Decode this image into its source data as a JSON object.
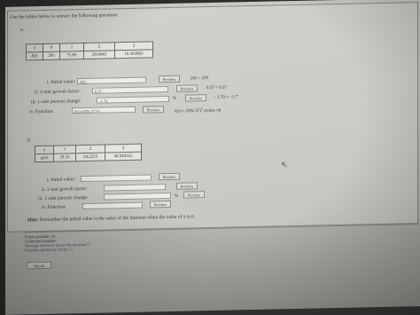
{
  "instructions": "Use the tables below to answer the following questions.",
  "part_a": {
    "label": "a.",
    "table": {
      "headers": [
        "x",
        "0",
        "1",
        "2",
        "3"
      ],
      "row_label": "f(x)",
      "values": [
        "205",
        "75.85",
        "28.0645",
        "10.383865"
      ]
    },
    "rows": [
      {
        "label": "i. Initial value:",
        "value": "205",
        "button": "Preview",
        "result": "205 = 205"
      },
      {
        "label": "ii. 1-unit growth factor:",
        "value": "0.37",
        "button": "Preview",
        "result": "0.37 = 0.37"
      },
      {
        "label": "iii. 1-unit percent change:",
        "value": "-1.70",
        "unit": "%",
        "button": "Preview",
        "result": "− 1.70 = −1.7"
      },
      {
        "label": "iv. Function:",
        "value": "f(x)=205(.37)^x",
        "button": "Preview",
        "result": "f(x) = 205(.37)",
        "result_sup": "x",
        "result_tail": "syntax ok"
      }
    ]
  },
  "part_b": {
    "label": "b.",
    "table": {
      "headers": [
        "x",
        "1",
        "2",
        "3"
      ],
      "row_label": "g(x)",
      "values": [
        "29.35",
        "34.2225",
        "40.049325"
      ]
    },
    "rows": [
      {
        "label": "i. Initial value:",
        "value": "",
        "button": "Preview"
      },
      {
        "label": "ii. 1-unit growth factor:",
        "value": "",
        "button": "Preview"
      },
      {
        "label": "iii. 1-unit percent change:",
        "value": "",
        "unit": "%",
        "button": "Preview"
      },
      {
        "label": "iv. Function:",
        "value": "",
        "button": "Preview"
      }
    ]
  },
  "hint": {
    "label": "Hint:",
    "text": "Remember the initial value is the value of the function when the value of x is 0."
  },
  "footer": {
    "points": "Points possible: 10",
    "attempts": "Unlimited attempts.",
    "message": "Message instructor about this question ☐",
    "forum": "Post this question to forum ☐"
  },
  "submit_label": "Submit"
}
